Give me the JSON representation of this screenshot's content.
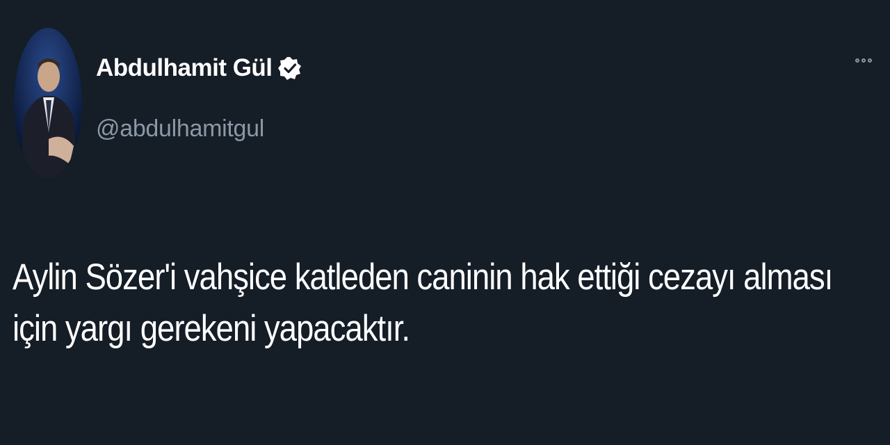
{
  "author": {
    "display_name": "Abdulhamit Gül",
    "handle": "@abdulhamitgul",
    "verified": true
  },
  "tweet": {
    "text": "Aylin Sözer'i vahşice katleden caninin hak ettiği cezayı alması için yargı gerekeni yapacaktır."
  },
  "icons": {
    "verified": "verified-badge-icon",
    "more": "more-options-icon"
  },
  "colors": {
    "background": "#151d27",
    "text": "#ffffff",
    "secondary": "#8b98a5"
  }
}
